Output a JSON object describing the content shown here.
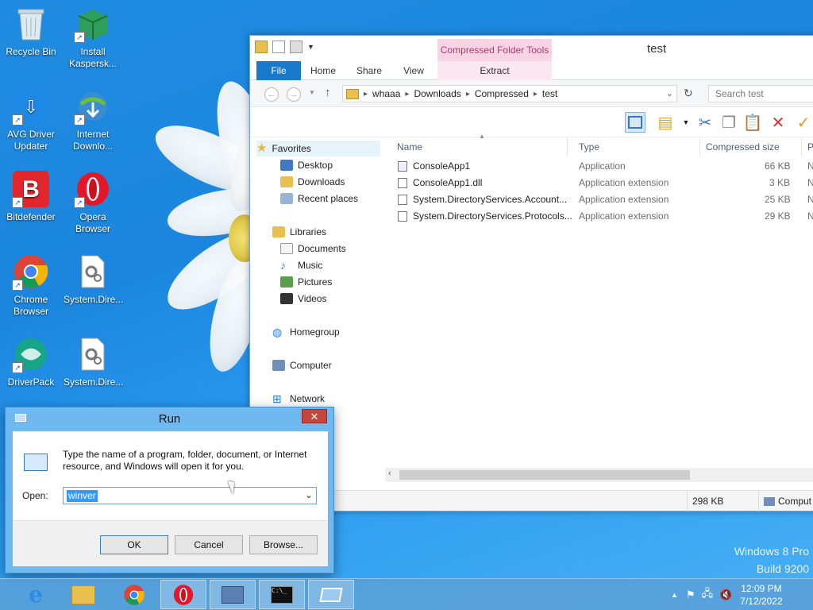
{
  "desktop": {
    "icons": [
      {
        "label": "Recycle Bin",
        "icon": "recycle-bin-icon"
      },
      {
        "label": "Install Kaspersk...",
        "icon": "kaspersky-installer-icon"
      },
      {
        "label": "AVG Driver Updater",
        "icon": "avg-driver-updater-icon"
      },
      {
        "label": "Internet Downlo...",
        "icon": "internet-download-manager-icon"
      },
      {
        "label": "Bitdefender",
        "icon": "bitdefender-icon"
      },
      {
        "label": "Opera Browser",
        "icon": "opera-icon"
      },
      {
        "label": "Chrome Browser",
        "icon": "chrome-icon"
      },
      {
        "label": "System.Dire...",
        "icon": "dll-file-icon"
      },
      {
        "label": "DriverPack",
        "icon": "driverpack-icon"
      },
      {
        "label": "System.Dire...",
        "icon": "dll-file-icon"
      }
    ],
    "watermark_line1": "Windows 8 Pro",
    "watermark_line2": "Build 9200"
  },
  "explorer": {
    "title": "test",
    "context_tab_group": "Compressed Folder Tools",
    "tabs": {
      "file": "File",
      "home": "Home",
      "share": "Share",
      "view": "View",
      "extract": "Extract"
    },
    "breadcrumb": [
      "whaaa",
      "Downloads",
      "Compressed",
      "test"
    ],
    "search_placeholder": "Search test",
    "nav": {
      "favorites": "Favorites",
      "desktop": "Desktop",
      "downloads": "Downloads",
      "recent": "Recent places",
      "libraries": "Libraries",
      "documents": "Documents",
      "music": "Music",
      "pictures": "Pictures",
      "videos": "Videos",
      "homegroup": "Homegroup",
      "computer": "Computer",
      "network": "Network"
    },
    "columns": {
      "name": "Name",
      "type": "Type",
      "compressed_size": "Compressed size",
      "extra": "P"
    },
    "files": [
      {
        "name": "ConsoleApp1",
        "type": "Application",
        "size": "66 KB",
        "extra": "N"
      },
      {
        "name": "ConsoleApp1.dll",
        "type": "Application extension",
        "size": "3 KB",
        "extra": "N"
      },
      {
        "name": "System.DirectoryServices.Account...",
        "type": "Application extension",
        "size": "25 KB",
        "extra": "N"
      },
      {
        "name": "System.DirectoryServices.Protocols...",
        "type": "Application extension",
        "size": "29 KB",
        "extra": "N"
      }
    ],
    "status": {
      "size": "298 KB",
      "location": "Comput"
    }
  },
  "run_dialog": {
    "title": "Run",
    "close_glyph": "✕",
    "description": "Type the name of a program, folder, document, or Internet resource, and Windows will open it for you.",
    "open_label": "Open:",
    "open_value": "winver",
    "ok": "OK",
    "cancel": "Cancel",
    "browse": "Browse..."
  },
  "taskbar": {
    "buttons": [
      "internet-explorer-icon",
      "file-explorer-icon",
      "chrome-icon",
      "opera-icon",
      "remote-desktop-icon",
      "command-prompt-icon",
      "run-icon"
    ],
    "time": "12:09 PM",
    "date": "7/12/2022"
  }
}
